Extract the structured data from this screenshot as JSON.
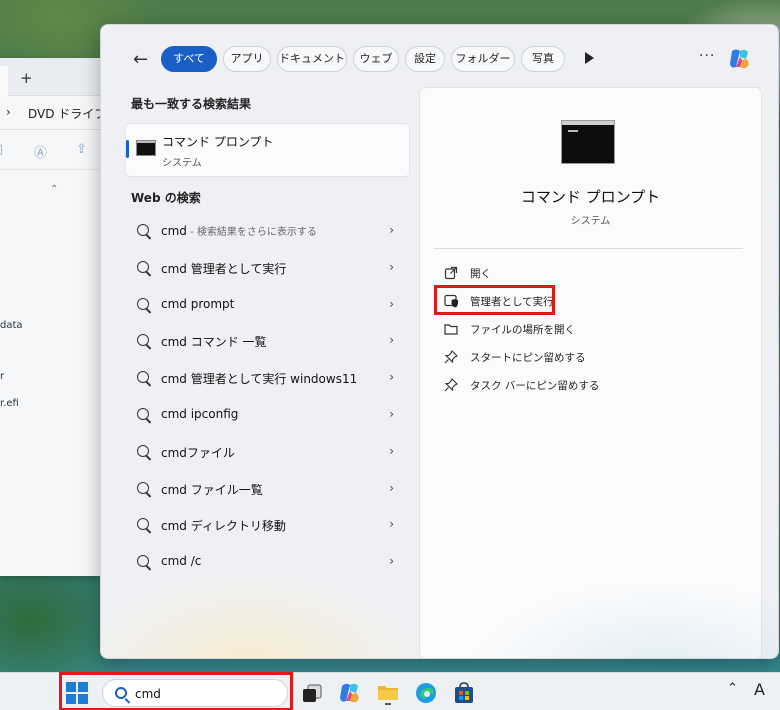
{
  "explorer": {
    "address": "DVD ドライブ (I",
    "files": [
      "data",
      "r",
      "r.efi"
    ]
  },
  "filters": {
    "items": [
      "すべて",
      "アプリ",
      "ドキュメント",
      "ウェブ",
      "設定",
      "フォルダー",
      "写真"
    ],
    "active": "すべて"
  },
  "best_match": {
    "section_title": "最も一致する検索結果",
    "name": "コマンド プロンプト",
    "type": "システム"
  },
  "web": {
    "section_title": "Web の検索",
    "items": [
      {
        "query": "cmd",
        "suffix": " - 検索結果をさらに表示する"
      },
      {
        "query": "cmd 管理者として実行",
        "suffix": ""
      },
      {
        "query": "cmd prompt",
        "suffix": ""
      },
      {
        "query": "cmd コマンド 一覧",
        "suffix": ""
      },
      {
        "query": "cmd 管理者として実行 windows11",
        "suffix": ""
      },
      {
        "query": "cmd ipconfig",
        "suffix": ""
      },
      {
        "query": "cmdファイル",
        "suffix": ""
      },
      {
        "query": "cmd ファイル一覧",
        "suffix": ""
      },
      {
        "query": "cmd ディレクトリ移動",
        "suffix": ""
      },
      {
        "query": "cmd /c",
        "suffix": ""
      }
    ]
  },
  "detail": {
    "title": "コマンド プロンプト",
    "subtitle": "システム",
    "actions": [
      {
        "label": "開く",
        "icon": "open-external-icon"
      },
      {
        "label": "管理者として実行",
        "icon": "shield-admin-icon"
      },
      {
        "label": "ファイルの場所を開く",
        "icon": "folder-icon"
      },
      {
        "label": "スタートにピン留めする",
        "icon": "pin-icon"
      },
      {
        "label": "タスク バーにピン留めする",
        "icon": "pin-icon"
      }
    ]
  },
  "taskbar": {
    "search_value": "cmd",
    "apps": [
      "task-view-icon",
      "copilot-icon",
      "file-explorer-icon",
      "edge-icon",
      "store-icon"
    ],
    "ime_indicator": "A"
  },
  "colors": {
    "accent": "#1a5fc8",
    "highlight": "#e01919"
  }
}
